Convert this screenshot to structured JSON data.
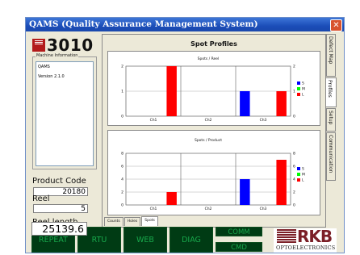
{
  "window": {
    "title": "QAMS (Quality Assurance Management System)",
    "close_glyph": "✕"
  },
  "left": {
    "logo_text": "3010",
    "logo_badge_text": "RKB",
    "machine_info_label": "Machine Information",
    "machine_info_lines": [
      "QAMS",
      "Version 2.1.0"
    ],
    "product_code_label": "Product Code",
    "product_code_value": "20180",
    "reel_label": "Reel",
    "reel_value": "5",
    "reel_length_label": "Reel length",
    "reel_length_value": "25139.6"
  },
  "main": {
    "title": "Spot Profiles",
    "sub_tabs": [
      "Counts",
      "Holes",
      "Spots"
    ],
    "active_sub_tab": "Spots"
  },
  "side_tabs": [
    "Defect Map",
    "Profiles",
    "Setup",
    "Communication"
  ],
  "active_side_tab": "Profiles",
  "bottom": {
    "buttons": [
      "REPEAT",
      "RTU",
      "WEB",
      "DIAG"
    ],
    "comm_label": "COMM",
    "cmd_label": "CMD",
    "brand_text": "RKB",
    "brand_sub": "OPTOELECTRONICS"
  },
  "colors": {
    "S": "#0000ff",
    "M": "#00ff00",
    "L": "#ff0000",
    "panel_bg": "#ece9d8",
    "title_blue": "#1b4db8",
    "nav_green": "#003b14"
  },
  "chart_data": [
    {
      "type": "bar",
      "title": "Spots / Reel",
      "categories": [
        "Ch1",
        "Ch2",
        "Ch3"
      ],
      "series": [
        {
          "name": "S",
          "values": [
            0,
            0,
            1
          ]
        },
        {
          "name": "M",
          "values": [
            0,
            0,
            0
          ]
        },
        {
          "name": "L",
          "values": [
            2,
            0,
            1
          ]
        }
      ],
      "ylim": [
        0,
        2
      ],
      "yticks": [
        0,
        1,
        2
      ],
      "legend": "right",
      "grid": true
    },
    {
      "type": "bar",
      "title": "Spots / Product",
      "categories": [
        "Ch1",
        "Ch2",
        "Ch3"
      ],
      "series": [
        {
          "name": "S",
          "values": [
            0,
            0,
            4
          ]
        },
        {
          "name": "M",
          "values": [
            0,
            0,
            0
          ]
        },
        {
          "name": "L",
          "values": [
            2,
            0,
            7
          ]
        }
      ],
      "ylim": [
        0,
        8
      ],
      "yticks": [
        0,
        2,
        4,
        6,
        8
      ],
      "legend": "right",
      "grid": true
    }
  ]
}
